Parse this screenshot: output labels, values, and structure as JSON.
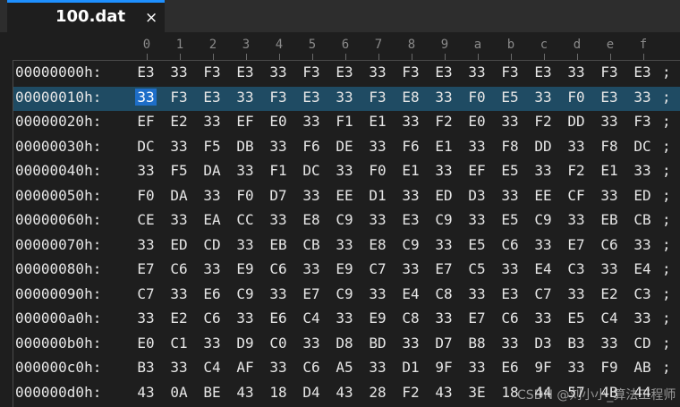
{
  "tab": {
    "title": "100.dat",
    "close_glyph": "×"
  },
  "ruler": {
    "columns": [
      "0",
      "1",
      "2",
      "3",
      "4",
      "5",
      "6",
      "7",
      "8",
      "9",
      "a",
      "b",
      "c",
      "d",
      "e",
      "f"
    ]
  },
  "editor": {
    "selected": {
      "row": 1,
      "col": 0
    },
    "highlight_color": "#1f4b63",
    "selection_color": "#1e6ec8",
    "rows": [
      {
        "address": "00000000h:",
        "bytes": [
          "E3",
          "33",
          "F3",
          "E3",
          "33",
          "F3",
          "E3",
          "33",
          "F3",
          "E3",
          "33",
          "F3",
          "E3",
          "33",
          "F3",
          "E3"
        ],
        "tail": ";"
      },
      {
        "address": "00000010h:",
        "bytes": [
          "33",
          "F3",
          "E3",
          "33",
          "F3",
          "E3",
          "33",
          "F3",
          "E8",
          "33",
          "F0",
          "E5",
          "33",
          "F0",
          "E3",
          "33"
        ],
        "tail": ";"
      },
      {
        "address": "00000020h:",
        "bytes": [
          "EF",
          "E2",
          "33",
          "EF",
          "E0",
          "33",
          "F1",
          "E1",
          "33",
          "F2",
          "E0",
          "33",
          "F2",
          "DD",
          "33",
          "F3"
        ],
        "tail": ";"
      },
      {
        "address": "00000030h:",
        "bytes": [
          "DC",
          "33",
          "F5",
          "DB",
          "33",
          "F6",
          "DE",
          "33",
          "F6",
          "E1",
          "33",
          "F8",
          "DD",
          "33",
          "F8",
          "DC"
        ],
        "tail": ";"
      },
      {
        "address": "00000040h:",
        "bytes": [
          "33",
          "F5",
          "DA",
          "33",
          "F1",
          "DC",
          "33",
          "F0",
          "E1",
          "33",
          "EF",
          "E5",
          "33",
          "F2",
          "E1",
          "33"
        ],
        "tail": ";"
      },
      {
        "address": "00000050h:",
        "bytes": [
          "F0",
          "DA",
          "33",
          "F0",
          "D7",
          "33",
          "EE",
          "D1",
          "33",
          "ED",
          "D3",
          "33",
          "EE",
          "CF",
          "33",
          "ED"
        ],
        "tail": ";"
      },
      {
        "address": "00000060h:",
        "bytes": [
          "CE",
          "33",
          "EA",
          "CC",
          "33",
          "E8",
          "C9",
          "33",
          "E3",
          "C9",
          "33",
          "E5",
          "C9",
          "33",
          "EB",
          "CB"
        ],
        "tail": ";"
      },
      {
        "address": "00000070h:",
        "bytes": [
          "33",
          "ED",
          "CD",
          "33",
          "EB",
          "CB",
          "33",
          "E8",
          "C9",
          "33",
          "E5",
          "C6",
          "33",
          "E7",
          "C6",
          "33"
        ],
        "tail": ";"
      },
      {
        "address": "00000080h:",
        "bytes": [
          "E7",
          "C6",
          "33",
          "E9",
          "C6",
          "33",
          "E9",
          "C7",
          "33",
          "E7",
          "C5",
          "33",
          "E4",
          "C3",
          "33",
          "E4"
        ],
        "tail": ";"
      },
      {
        "address": "00000090h:",
        "bytes": [
          "C7",
          "33",
          "E6",
          "C9",
          "33",
          "E7",
          "C9",
          "33",
          "E4",
          "C8",
          "33",
          "E3",
          "C7",
          "33",
          "E2",
          "C3"
        ],
        "tail": ";"
      },
      {
        "address": "000000a0h:",
        "bytes": [
          "33",
          "E2",
          "C6",
          "33",
          "E6",
          "C4",
          "33",
          "E9",
          "C8",
          "33",
          "E7",
          "C6",
          "33",
          "E5",
          "C4",
          "33"
        ],
        "tail": ";"
      },
      {
        "address": "000000b0h:",
        "bytes": [
          "E0",
          "C1",
          "33",
          "D9",
          "C0",
          "33",
          "D8",
          "BD",
          "33",
          "D7",
          "B8",
          "33",
          "D3",
          "B3",
          "33",
          "CD"
        ],
        "tail": ";"
      },
      {
        "address": "000000c0h:",
        "bytes": [
          "B3",
          "33",
          "C4",
          "AF",
          "33",
          "C6",
          "A5",
          "33",
          "D1",
          "9F",
          "33",
          "E6",
          "9F",
          "33",
          "F9",
          "AB"
        ],
        "tail": ";"
      },
      {
        "address": "000000d0h:",
        "bytes": [
          "43",
          "0A",
          "BE",
          "43",
          "18",
          "D4",
          "43",
          "28",
          "F2",
          "43",
          "3E",
          "18",
          "44",
          "57",
          "4B",
          "44"
        ],
        "tail": ""
      }
    ]
  },
  "watermark": "CSDN @刘小小_算法工程师"
}
